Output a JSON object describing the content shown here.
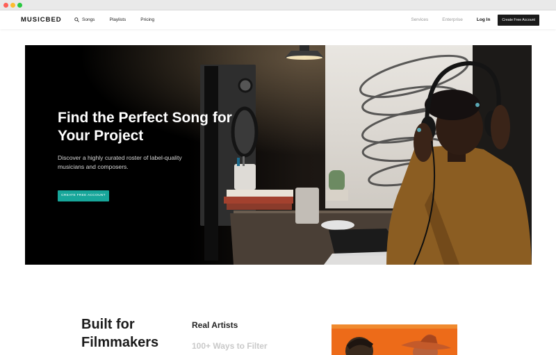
{
  "browser": {
    "controls": [
      "close",
      "minimize",
      "maximize"
    ]
  },
  "header": {
    "logo": "MUSICBED",
    "nav_left": [
      {
        "label": "Songs",
        "icon": "search-icon"
      },
      {
        "label": "Playlists"
      },
      {
        "label": "Pricing"
      }
    ],
    "nav_right_muted": [
      "Services",
      "Enterprise"
    ],
    "login": "Log In",
    "cta": "Create Free Account"
  },
  "hero": {
    "title": "Find the Perfect Song for Your Project",
    "subtitle": "Discover a highly curated roster of label-quality musicians and composers.",
    "cta": "CREATE FREE ACCOUNT",
    "cta_color": "#17a69a"
  },
  "features": {
    "heading": "Built for Filmmakers",
    "items": [
      "Real Artists",
      "100+ Ways to Filter"
    ]
  },
  "colors": {
    "header_cta_bg": "#1a1a1a",
    "accent": "#17a69a",
    "muted_text": "#9a9a9a",
    "feature_image_bg": "#ed6b19"
  }
}
